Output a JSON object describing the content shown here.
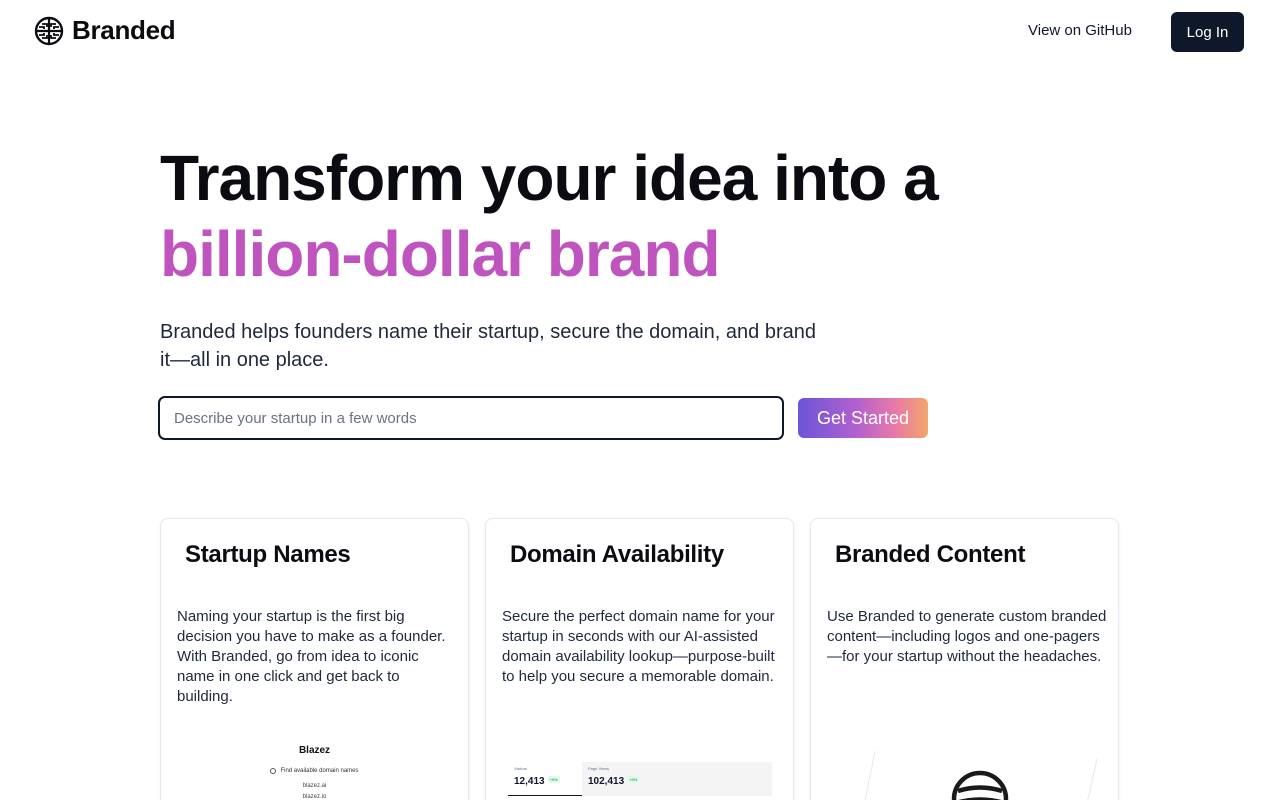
{
  "header": {
    "brand_name": "Branded",
    "github_link": "View on GitHub",
    "login_button": "Log In"
  },
  "hero": {
    "title_line1": "Transform your idea into a",
    "title_line2": "billion-dollar brand",
    "subtitle": "Branded helps founders name their startup, secure the domain, and brand it—all in one place.",
    "search_placeholder": "Describe your startup in a few words",
    "search_value": "",
    "cta_label": "Get Started"
  },
  "cards": [
    {
      "title": "Startup Names",
      "description": "Naming your startup is the first big decision you have to make as a founder. With Branded, go from idea to iconic name in one click and get back to building.",
      "preview": {
        "title": "Blazez",
        "find_label": "Find available domain names",
        "domains": [
          "blazez.ai",
          "blazez.io"
        ]
      }
    },
    {
      "title": "Domain Availability",
      "description": "Secure the perfect domain name for your startup in seconds with our AI-assisted domain availability lookup—purpose-built to help you secure a memorable domain.",
      "preview": {
        "stats": [
          {
            "label": "Visitors",
            "value": "12,413",
            "badge": "+9%"
          },
          {
            "label": "Page Views",
            "value": "102,413",
            "badge": "+9%"
          }
        ]
      }
    },
    {
      "title": "Branded Content",
      "description": "Use Branded to generate custom branded content—including logos and one-pagers—for your startup without the headaches."
    }
  ],
  "colors": {
    "accent": "#c054bf",
    "dark": "#0f172a",
    "cta_gradient": [
      "#6b55d8",
      "#b260cf",
      "#e97aa6",
      "#f3a56c"
    ]
  },
  "icons": {
    "brand_logo": "globe-maze-icon",
    "domain_search": "globe-icon",
    "content_logo": "circle-lines-logo-icon"
  }
}
